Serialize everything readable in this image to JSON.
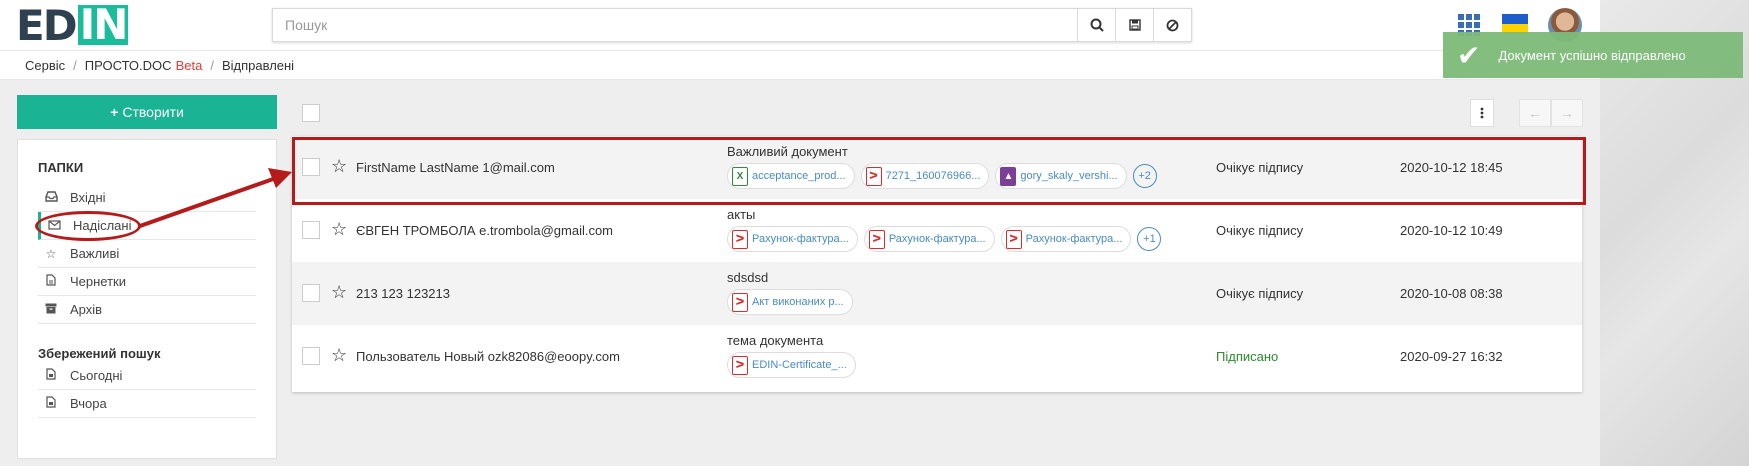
{
  "header": {
    "logo_text": "EDIN",
    "search_placeholder": "Пошук",
    "icons": [
      "search-icon",
      "save-icon",
      "cancel-icon",
      "apps-grid-icon",
      "flag-ua-icon",
      "avatar"
    ]
  },
  "breadcrumb": {
    "items": [
      "Сервіс",
      "ПРОСТО.DOC",
      "Відправлені"
    ],
    "beta_label": "Beta"
  },
  "toast": {
    "message": "Документ успішно відправлено"
  },
  "sidebar": {
    "create_label": "Створити",
    "folders_title": "ПАПКИ",
    "folders": [
      {
        "label": "Вхідні",
        "icon": "inbox-icon"
      },
      {
        "label": "Надіслані",
        "icon": "envelope-icon"
      },
      {
        "label": "Важливі",
        "icon": "star-icon"
      },
      {
        "label": "Чернетки",
        "icon": "file-icon"
      },
      {
        "label": "Архів",
        "icon": "archive-icon"
      }
    ],
    "saved_title": "Збережений пошук",
    "saved": [
      {
        "label": "Сьогодні",
        "icon": "file-icon"
      },
      {
        "label": "Вчора",
        "icon": "file-icon"
      }
    ]
  },
  "documents": [
    {
      "sender": "FirstName LastName 1@mail.com",
      "subject": "Важливий документ",
      "attachments": [
        {
          "name": "acceptance_prod...",
          "type": "xls"
        },
        {
          "name": "7271_160076966...",
          "type": "pdf"
        },
        {
          "name": "gory_skaly_vershi...",
          "type": "img"
        }
      ],
      "more": "+2",
      "status": "Очікує підпису",
      "date": "2020-10-12 18:45"
    },
    {
      "sender": "ЄВГЕН ТРОМБОЛА e.trombola@gmail.com",
      "subject": "акты",
      "attachments": [
        {
          "name": "Рахунок-фактура...",
          "type": "pdf"
        },
        {
          "name": "Рахунок-фактура...",
          "type": "pdf"
        },
        {
          "name": "Рахунок-фактура...",
          "type": "pdf"
        }
      ],
      "more": "+1",
      "status": "Очікує підпису",
      "date": "2020-10-12 10:49"
    },
    {
      "sender": "213 123 123213",
      "subject": "sdsdsd",
      "attachments": [
        {
          "name": "Акт виконаних р...",
          "type": "pdf"
        }
      ],
      "more": "",
      "status": "Очікує підпису",
      "date": "2020-10-08 08:38"
    },
    {
      "sender": "Пользователь Новый ozk82086@eoopy.com",
      "subject": "тема документа",
      "attachments": [
        {
          "name": "EDIN-Certificate_...",
          "type": "pdf"
        }
      ],
      "more": "",
      "status": "Підписано",
      "date": "2020-09-27 16:32"
    }
  ],
  "colors": {
    "accent": "#1ab394",
    "annotation": "#b51b1b",
    "toast": "#7dbb79",
    "signed": "#2e8b2e",
    "link": "#4a8bc2"
  }
}
